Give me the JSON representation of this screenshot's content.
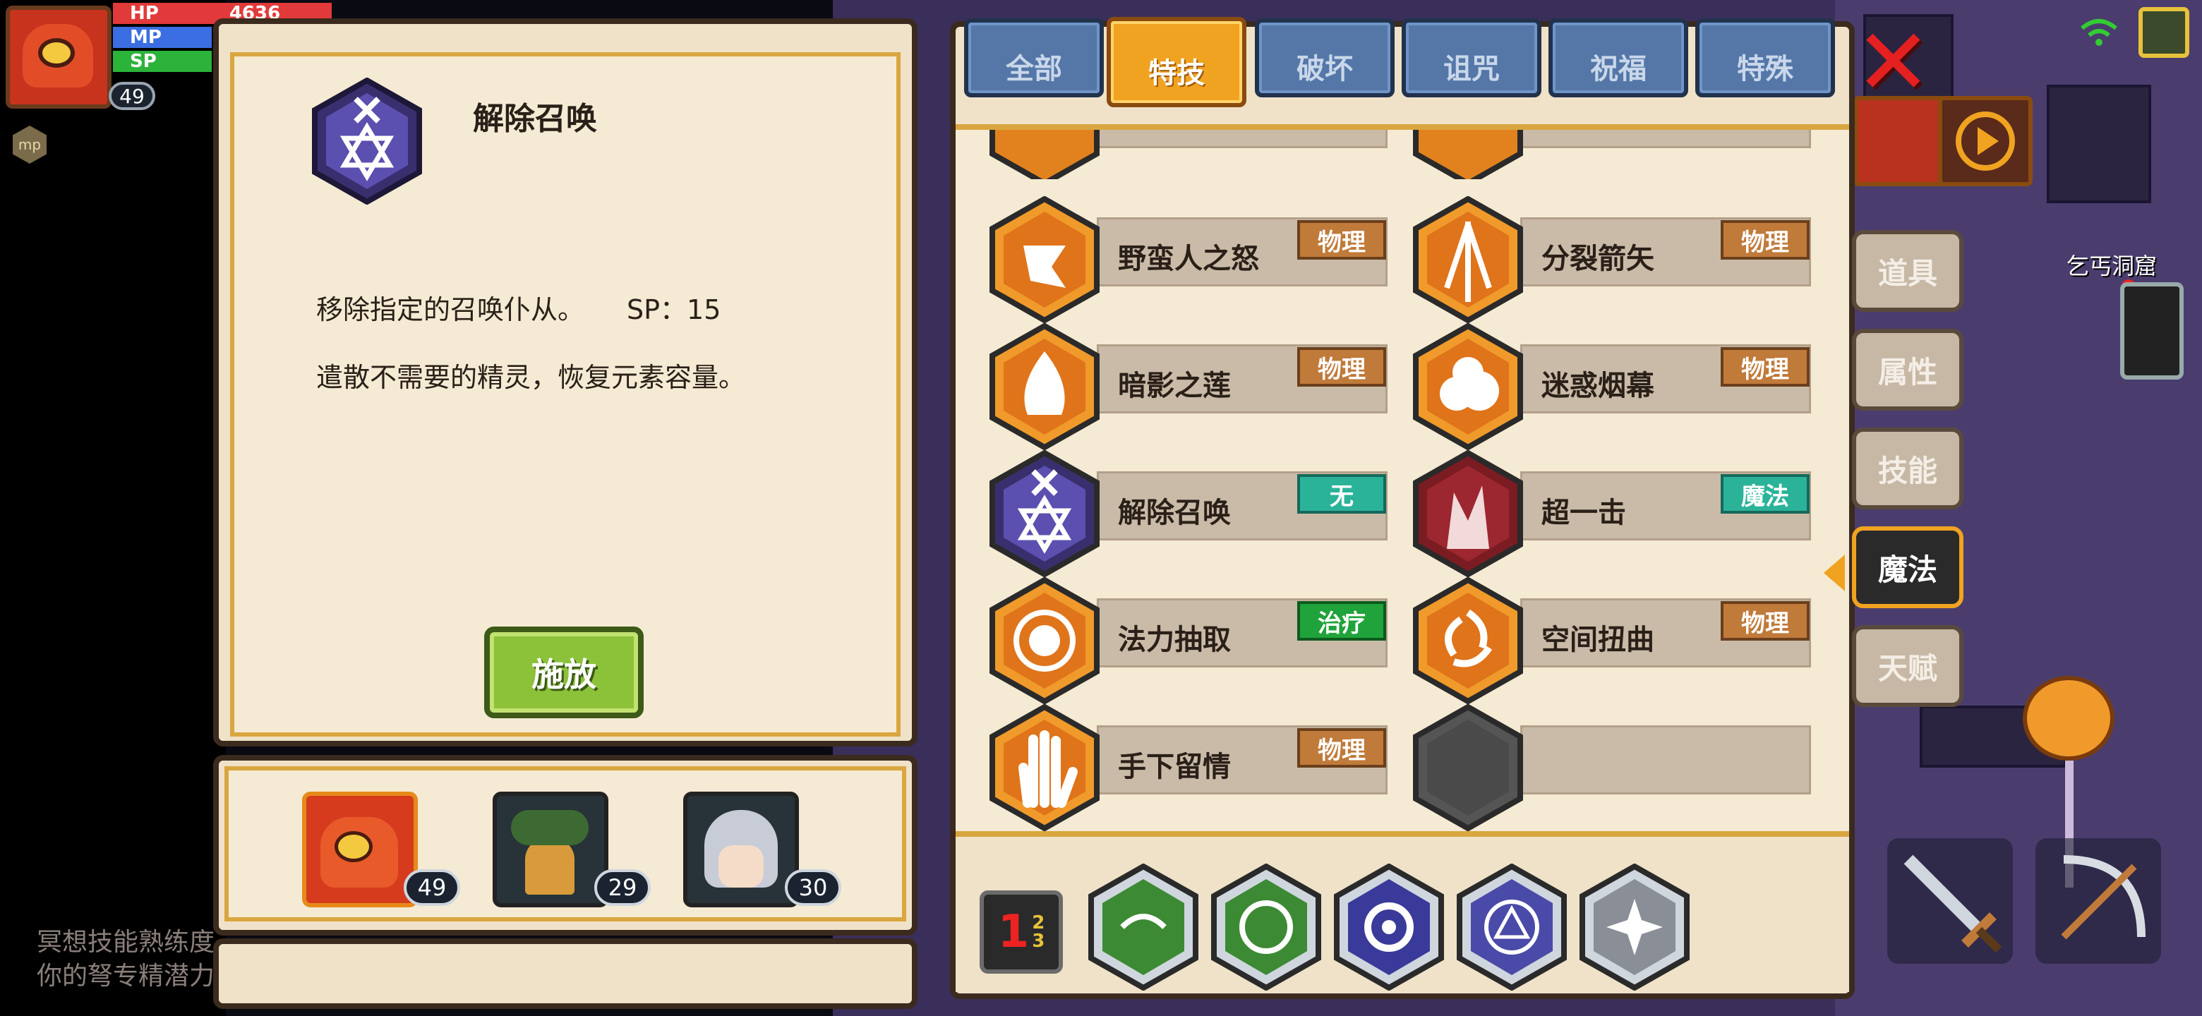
{
  "hud": {
    "hp_label": "HP",
    "hp_value": "4636",
    "mp_label": "MP",
    "sp_label": "SP",
    "level": "49",
    "mp_icon_text": "mp",
    "hp_color": "#e23a3a",
    "mp_color": "#3a6ee2",
    "sp_color": "#2bb33a"
  },
  "detail": {
    "title": "解除召唤",
    "description": "移除指定的召唤仆从。",
    "sp_cost": "SP：15",
    "lore": "遣散不需要的精灵，恢复元素容量。",
    "cast_label": "施放",
    "icon": "star-of-david-summon-icon"
  },
  "team": [
    {
      "level": "49",
      "icon": "lion-dance-hero-portrait"
    },
    {
      "level": "29",
      "icon": "bell-flower-pet-portrait"
    },
    {
      "level": "30",
      "icon": "silver-hair-girl-portrait"
    }
  ],
  "chat": {
    "line1": "冥想技能熟练度",
    "line2": "你的弩专精潜力"
  },
  "tabs": [
    {
      "label": "全部"
    },
    {
      "label": "特技"
    },
    {
      "label": "破坏"
    },
    {
      "label": "诅咒"
    },
    {
      "label": "祝福"
    },
    {
      "label": "特殊"
    }
  ],
  "active_tab": "特技",
  "skills": [
    {
      "name": "野蛮人之怒",
      "tag": "物理",
      "icon": "barbarian-fury-icon"
    },
    {
      "name": "分裂箭矢",
      "tag": "物理",
      "icon": "split-arrow-icon"
    },
    {
      "name": "暗影之莲",
      "tag": "物理",
      "icon": "shadow-lotus-flame-icon"
    },
    {
      "name": "迷惑烟幕",
      "tag": "物理",
      "icon": "smoke-screen-icon"
    },
    {
      "name": "解除召唤",
      "tag": "无",
      "icon": "dismiss-summon-icon"
    },
    {
      "name": "超一击",
      "tag": "魔法",
      "icon": "super-strike-icon"
    },
    {
      "name": "法力抽取",
      "tag": "治疗",
      "icon": "mana-drain-icon"
    },
    {
      "name": "空间扭曲",
      "tag": "物理",
      "icon": "space-warp-icon"
    },
    {
      "name": "手下留情",
      "tag": "物理",
      "icon": "mercy-hand-icon"
    }
  ],
  "page_indicator": {
    "current": "1",
    "rest_a": "2",
    "rest_b": "3"
  },
  "side_tabs": [
    {
      "label": "道具"
    },
    {
      "label": "属性"
    },
    {
      "label": "技能"
    },
    {
      "label": "魔法"
    },
    {
      "label": "天赋"
    }
  ],
  "active_side_tab": "魔法",
  "map_label": "乞丐洞窟",
  "colors": {
    "panel": "#efe2c8",
    "accent_orange": "#f0a321",
    "tab_blue": "#5477a8",
    "tag_physical": "#c07a3a",
    "tag_none": "#2bb39a",
    "tag_heal": "#1fa33a"
  }
}
